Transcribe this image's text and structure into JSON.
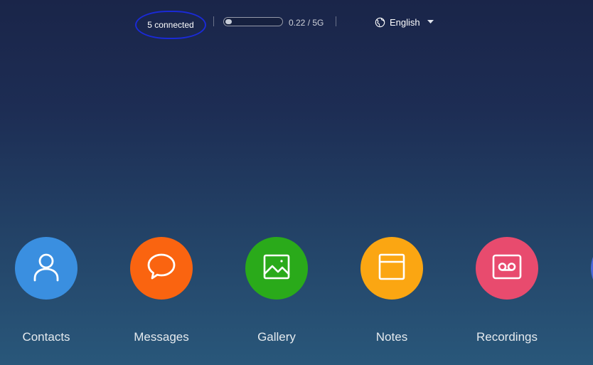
{
  "header": {
    "connected_label": "5 connected",
    "storage": {
      "text": "0.22 / 5G",
      "used_fraction": 0.044
    },
    "language": {
      "label": "English",
      "icon": "globe-icon",
      "dropdown_icon": "caret-down-icon"
    }
  },
  "apps": [
    {
      "label": "Contacts",
      "icon": "person-icon",
      "color": "#3a8fe0"
    },
    {
      "label": "Messages",
      "icon": "chat-bubble-icon",
      "color": "#fa6410"
    },
    {
      "label": "Gallery",
      "icon": "image-icon",
      "color": "#2aaa1a"
    },
    {
      "label": "Notes",
      "icon": "note-icon",
      "color": "#fba612"
    },
    {
      "label": "Recordings",
      "icon": "cassette-icon",
      "color": "#e84b6e"
    },
    {
      "label": "",
      "icon": "partial-app-icon",
      "color": "#4a68d8"
    }
  ]
}
